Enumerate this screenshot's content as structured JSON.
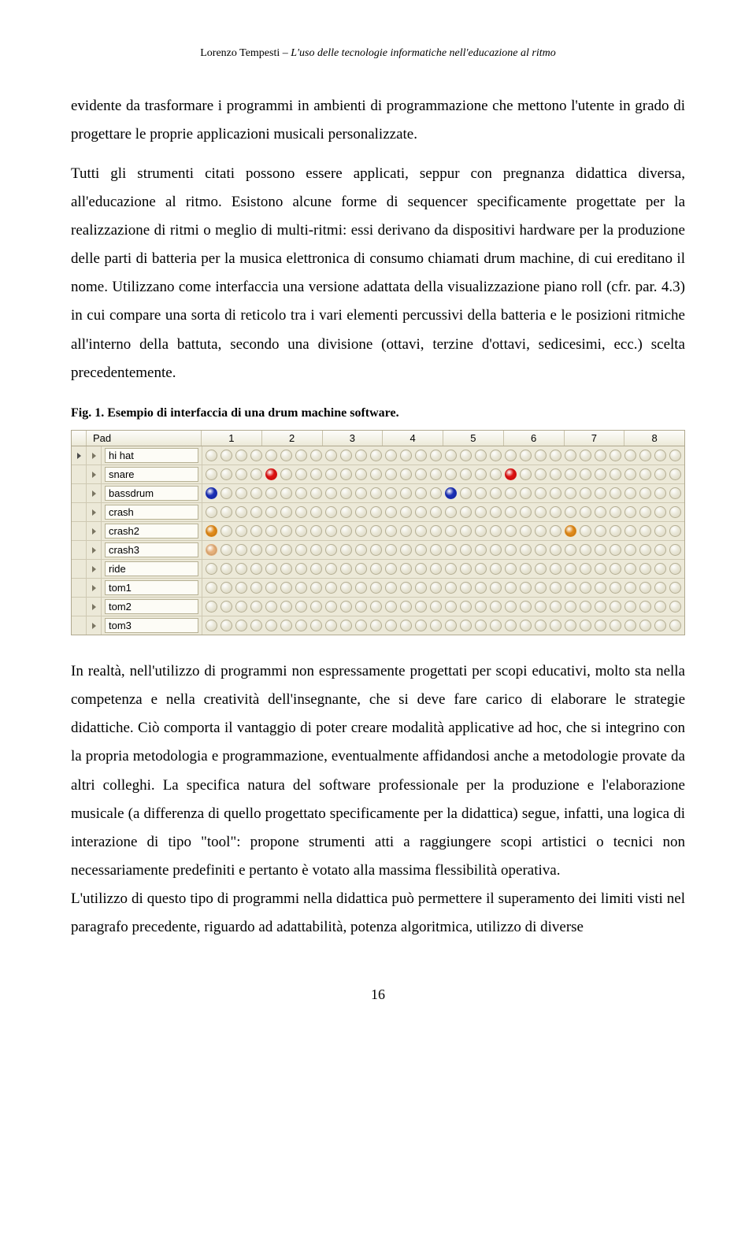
{
  "header": {
    "author": "Lorenzo Tempesti – ",
    "title": "L'uso delle tecnologie informatiche nell'educazione al ritmo"
  },
  "p1": "evidente da trasformare i programmi in ambienti di programmazione che mettono l'utente in grado di progettare le proprie applicazioni musicali personalizzate.",
  "p2": "Tutti gli strumenti citati possono essere applicati, seppur con pregnanza didattica diversa, all'educazione al ritmo. Esistono alcune forme di sequencer specificamente progettate per la realizzazione di ritmi o meglio di multi-ritmi: essi derivano da dispositivi hardware per la produzione delle parti di batteria per la musica elettronica di consumo chiamati drum machine, di cui ereditano il nome. Utilizzano come interfaccia una versione adattata della visualizzazione piano roll (cfr. par. 4.3) in cui compare una sorta di reticolo tra i vari elementi percussivi della batteria e le posizioni ritmiche all'interno della battuta, secondo una divisione (ottavi, terzine d'ottavi, sedicesimi, ecc.) scelta precedentemente.",
  "figcap": "Fig. 1. Esempio di interfaccia di una drum machine software.",
  "drum": {
    "padLabel": "Pad",
    "cols": [
      "1",
      "2",
      "3",
      "4",
      "5",
      "6",
      "7",
      "8"
    ],
    "tracks": [
      {
        "name": "hi hat",
        "active": true,
        "steps": []
      },
      {
        "name": "snare",
        "active": false,
        "steps": [
          {
            "i": 4,
            "c": "#d11"
          },
          {
            "i": 20,
            "c": "#d11"
          }
        ]
      },
      {
        "name": "bassdrum",
        "active": false,
        "steps": [
          {
            "i": 0,
            "c": "#1a2fb5"
          },
          {
            "i": 16,
            "c": "#1a2fb5"
          }
        ]
      },
      {
        "name": "crash",
        "active": false,
        "steps": []
      },
      {
        "name": "crash2",
        "active": false,
        "steps": [
          {
            "i": 0,
            "c": "#e08a1a"
          },
          {
            "i": 24,
            "c": "#e08a1a"
          }
        ]
      },
      {
        "name": "crash3",
        "active": false,
        "steps": [
          {
            "i": 0,
            "c": "#e6b07a"
          }
        ]
      },
      {
        "name": "ride",
        "active": false,
        "steps": []
      },
      {
        "name": "tom1",
        "active": false,
        "steps": []
      },
      {
        "name": "tom2",
        "active": false,
        "steps": []
      },
      {
        "name": "tom3",
        "active": false,
        "steps": []
      }
    ],
    "stepsPerRow": 32
  },
  "p3": "In realtà, nell'utilizzo di programmi non espressamente progettati per scopi educativi, molto sta nella competenza e nella creatività dell'insegnante, che si deve fare carico di elaborare le strategie didattiche. Ciò comporta il vantaggio di poter creare modalità applicative ad hoc, che si integrino con la propria metodologia e programmazione, eventualmente affidandosi anche a metodologie provate da altri colleghi. La specifica natura del software professionale per la produzione e l'elaborazione musicale (a differenza di quello progettato specificamente per la didattica) segue, infatti, una logica di interazione di tipo \"tool\": propone strumenti atti a raggiungere scopi artistici o tecnici non necessariamente predefiniti e pertanto è votato alla massima flessibilità operativa.",
  "p4": "L'utilizzo di questo tipo di programmi nella didattica può permettere il superamento dei limiti visti nel paragrafo precedente, riguardo ad adattabilità, potenza algoritmica, utilizzo di diverse",
  "pageNumber": "16"
}
